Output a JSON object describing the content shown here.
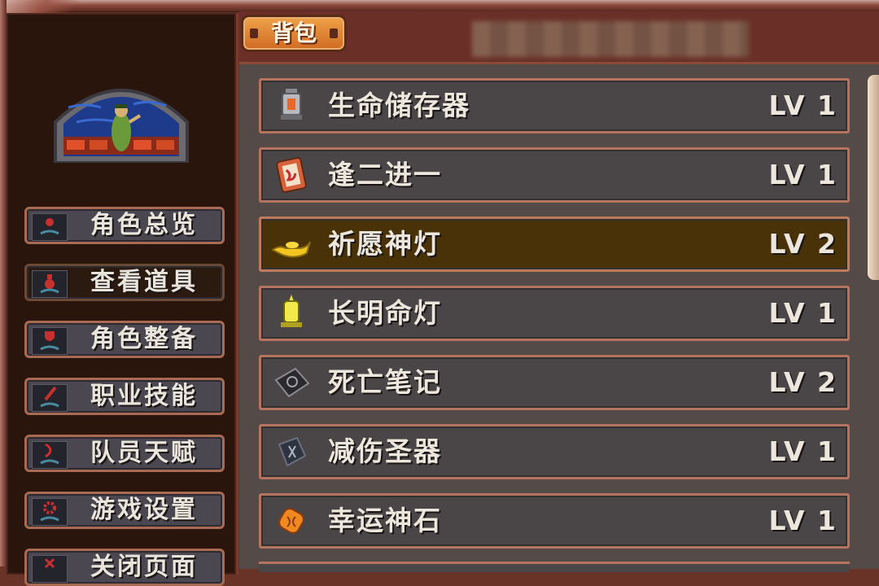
{
  "backpack_tab": {
    "label": "背包"
  },
  "sidebar": {
    "menu": [
      {
        "label": "角色总览",
        "icon": "character-icon",
        "active": false
      },
      {
        "label": "查看道具",
        "icon": "potion-icon",
        "active": true
      },
      {
        "label": "角色整备",
        "icon": "shield-icon",
        "active": false
      },
      {
        "label": "职业技能",
        "icon": "sword-icon",
        "active": false
      },
      {
        "label": "队员天赋",
        "icon": "dna-icon",
        "active": false
      },
      {
        "label": "游戏设置",
        "icon": "gear-icon",
        "active": false
      },
      {
        "label": "关闭页面",
        "icon": "close-icon",
        "active": false
      }
    ]
  },
  "items": [
    {
      "name": "生命储存器",
      "level": "LV 1",
      "icon": "lantern-icon",
      "selected": false
    },
    {
      "name": "逢二进一",
      "level": "LV 1",
      "icon": "card-icon",
      "selected": false
    },
    {
      "name": "祈愿神灯",
      "level": "LV 2",
      "icon": "magic-lamp-icon",
      "selected": true
    },
    {
      "name": "长明命灯",
      "level": "LV 1",
      "icon": "oil-lamp-icon",
      "selected": false
    },
    {
      "name": "死亡笔记",
      "level": "LV 2",
      "icon": "book-icon",
      "selected": false
    },
    {
      "name": "减伤圣器",
      "level": "LV 1",
      "icon": "rune-stone-icon",
      "selected": false
    },
    {
      "name": "幸运神石",
      "level": "LV 1",
      "icon": "lucky-stone-icon",
      "selected": false
    }
  ],
  "colors": {
    "selected_row": "#4a3208",
    "row_border": "#b5745e",
    "tab": "#e08a36"
  }
}
